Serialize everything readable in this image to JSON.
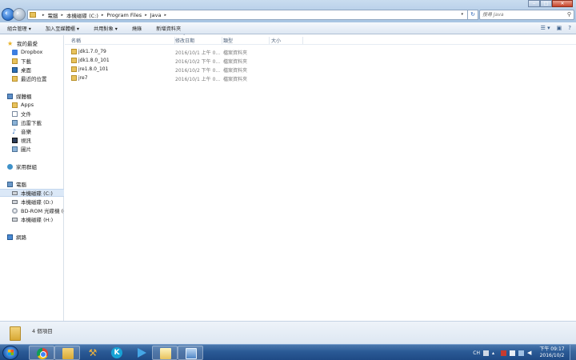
{
  "address": {
    "crumbs": [
      "電腦",
      "本機磁碟 (C:)",
      "Program Files",
      "Java"
    ]
  },
  "search": {
    "placeholder": "搜尋 Java"
  },
  "window_controls": {
    "minimize": "‒",
    "maximize": "□",
    "close": "✕"
  },
  "toolbar": {
    "items": [
      "組合管理 ▾",
      "加入至媒體櫃 ▾",
      "共用對象 ▾",
      "燒錄",
      "新增資料夾"
    ]
  },
  "nav": {
    "favorites": [
      "我的最愛",
      "Dropbox",
      "下載",
      "桌面",
      "最近的位置"
    ],
    "libraries": [
      "媒體櫃",
      "Apps",
      "文件",
      "迅雷下載",
      "音樂",
      "視訊",
      "圖片"
    ],
    "homegroup": "家用群組",
    "computer": [
      "電腦",
      "本機磁碟 (C:)",
      "本機磁碟 (D:)",
      "BD-ROM 光碟機 (G",
      "本機磁碟 (H:)"
    ],
    "network": "網路"
  },
  "columns": [
    "名稱",
    "修改日期",
    "類型",
    "大小"
  ],
  "files": [
    {
      "name": "jdk1.7.0_79",
      "date": "2016/10/1 上午 0...",
      "type": "檔案資料夾"
    },
    {
      "name": "jdk1.8.0_101",
      "date": "2016/10/2 下午 0...",
      "type": "檔案資料夾"
    },
    {
      "name": "jre1.8.0_101",
      "date": "2016/10/2 下午 0...",
      "type": "檔案資料夾"
    },
    {
      "name": "jre7",
      "date": "2016/10/1 上午 0...",
      "type": "檔案資料夾"
    }
  ],
  "status": {
    "text": "4 個項目"
  },
  "taskbar": {
    "apps": [
      "chrome-icon",
      "file-explorer-icon",
      "tool-icon",
      "k-app-icon",
      "media-player-icon",
      "folder-window-icon",
      "window-app-icon"
    ],
    "tray": {
      "lang": "CH",
      "time": "下午 09:17",
      "date": "2016/10/2"
    }
  }
}
